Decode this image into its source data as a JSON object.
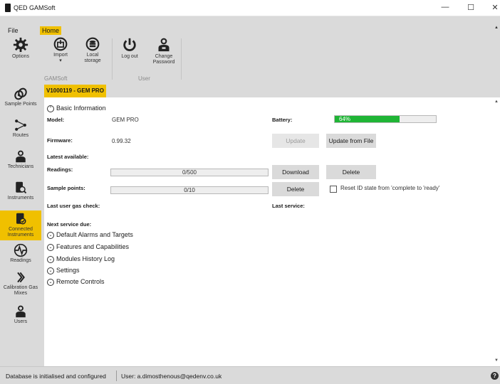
{
  "window": {
    "title": "QED GAMSoft",
    "minimize_glyph": "—",
    "maximize_glyph": "☐",
    "close_glyph": "✕"
  },
  "menu": {
    "tabs": [
      {
        "label": "File",
        "active": false
      },
      {
        "label": "Home",
        "active": true
      }
    ]
  },
  "ribbon": {
    "buttons": {
      "options": {
        "label": "Options",
        "icon": "gear-icon"
      },
      "import": {
        "label": "Import",
        "sub": "▾",
        "icon": "import-icon"
      },
      "local_storage": {
        "label": "Local storage",
        "icon": "database-icon"
      },
      "logout": {
        "label": "Log out",
        "icon": "power-icon"
      },
      "change_password": {
        "label": "Change Password",
        "icon": "user-key-icon"
      }
    },
    "groups": {
      "gamsoft": "GAMSoft",
      "user": "User"
    }
  },
  "sidebar": {
    "items": [
      {
        "label": "Sample Points",
        "icon": "sample-points-icon",
        "active": false
      },
      {
        "label": "Routes",
        "icon": "routes-icon",
        "active": false
      },
      {
        "label": "Technicians",
        "icon": "technician-icon",
        "active": false
      },
      {
        "label": "Instruments",
        "icon": "instrument-search-icon",
        "active": false
      },
      {
        "label": "Connected Instruments",
        "icon": "connected-instrument-icon",
        "active": true
      },
      {
        "label": "Readings",
        "icon": "readings-pulse-icon",
        "active": false
      },
      {
        "label": "Calibration Gas Mixes",
        "icon": "calibration-gas-icon",
        "active": false
      },
      {
        "label": "Users",
        "icon": "users-icon",
        "active": false
      }
    ]
  },
  "device": {
    "tag": "V1000119 - GEM PRO"
  },
  "basic_info": {
    "title": "Basic Information",
    "model_label": "Model:",
    "model_value": "GEM PRO",
    "battery_label": "Battery:",
    "battery_percent": 64,
    "battery_text": "64%",
    "firmware_label": "Firmware:",
    "firmware_value": "0.99.32",
    "latest_label": "Latest available:",
    "readings_label": "Readings:",
    "readings_text": "0/500",
    "readings_fraction": 0,
    "sample_points_label": "Sample points:",
    "sample_points_text": "0/10",
    "sample_points_fraction": 0,
    "last_gas_check_label": "Last user gas check:",
    "last_service_label": "Last service:",
    "next_service_label": "Next service due:"
  },
  "actions": {
    "update": "Update",
    "update_from_file": "Update from File",
    "download": "Download",
    "delete": "Delete",
    "delete_points": "Delete",
    "reset_id_label": "Reset ID state from 'complete to 'ready'",
    "reset_id_checked": false
  },
  "sections": [
    "Default Alarms and Targets",
    "Features and Capabilities",
    "Modules History Log",
    "Settings",
    "Remote Controls"
  ],
  "status": {
    "db": "Database is initialised and configured",
    "user": "User: a.dimosthenous@qedenv.co.uk",
    "help": "?"
  },
  "colors": {
    "accent": "#f0c000",
    "battery_fill": "#1fb535",
    "chrome": "#dadada"
  }
}
